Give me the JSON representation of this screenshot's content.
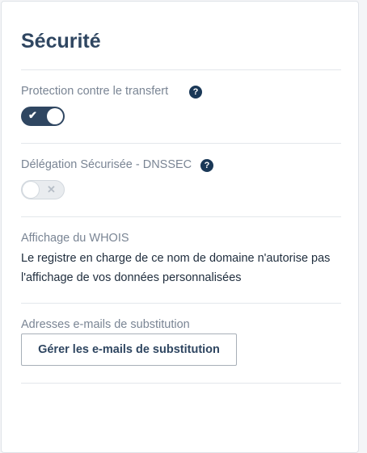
{
  "section": {
    "title": "Sécurité"
  },
  "transfer_protection": {
    "label": "Protection contre le transfert",
    "help_glyph": "?",
    "enabled": true,
    "toggle_glyph": "✔"
  },
  "dnssec": {
    "label": "Délégation Sécurisée - DNSSEC",
    "help_glyph": "?",
    "enabled": false,
    "toggle_glyph": "✕"
  },
  "whois": {
    "label": "Affichage du WHOIS",
    "text": "Le registre en charge de ce nom de domaine n'autorise pas l'affichage de vos données personnalisées"
  },
  "substitution_emails": {
    "label": "Adresses e-mails de substitution",
    "button_label": "Gérer les e-mails de substitution"
  },
  "colors": {
    "heading": "#2f4661",
    "help_icon": "#1a3857",
    "label": "#7a8594",
    "toggle_on": "#2f4661",
    "toggle_off": "#e9ecef"
  }
}
